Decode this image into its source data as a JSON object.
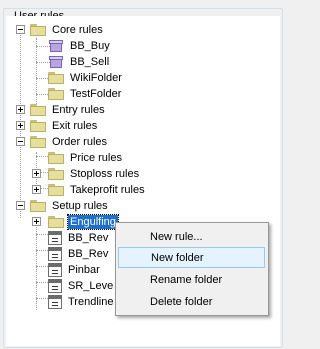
{
  "group_title": "User rules",
  "tree": {
    "core_rules": "Core rules",
    "bb_buy": "BB_Buy",
    "bb_sell": "BB_Sell",
    "wiki_folder": "WikiFolder",
    "test_folder": "TestFolder",
    "entry_rules": "Entry rules",
    "exit_rules": "Exit rules",
    "order_rules": "Order rules",
    "price_rules": "Price rules",
    "stoploss_rules": "Stoploss rules",
    "takeprofit_rules": "Takeprofit rules",
    "setup_rules": "Setup rules",
    "engulfing": "Engulfing",
    "bb_rev_1": "BB_Rev",
    "bb_rev_2": "BB_Rev",
    "pinbar": "Pinbar",
    "sr_level": "SR_Leve",
    "trendline": "Trendline"
  },
  "context_menu": {
    "new_rule": "New rule...",
    "new_folder": "New folder",
    "rename_folder": "Rename folder",
    "delete_folder": "Delete folder"
  }
}
